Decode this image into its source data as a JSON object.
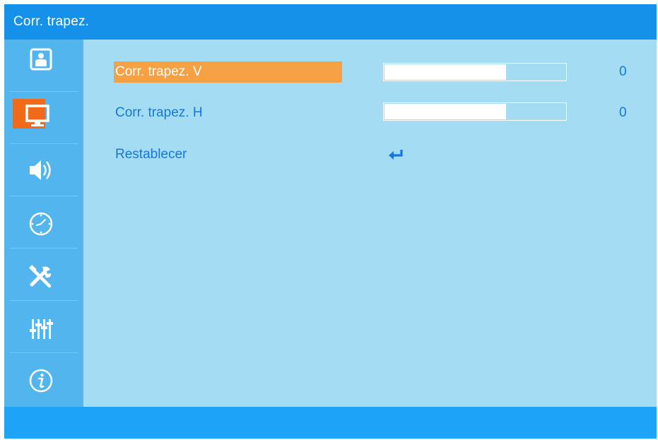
{
  "title_bar": {
    "title": "Corr. trapez."
  },
  "sidebar": {
    "items": [
      {
        "icon": "image-icon",
        "selected": false
      },
      {
        "icon": "display-icon",
        "selected": true
      },
      {
        "icon": "speaker-icon",
        "selected": false
      },
      {
        "icon": "clock-icon",
        "selected": false
      },
      {
        "icon": "tools-icon",
        "selected": false
      },
      {
        "icon": "equalizer-icon",
        "selected": false
      },
      {
        "icon": "info-icon",
        "selected": false
      }
    ]
  },
  "menu": {
    "rows": [
      {
        "label": "Corr. trapez. V",
        "value": "0",
        "level": 0.67,
        "active": true
      },
      {
        "label": "Corr. trapez. H",
        "value": "0",
        "level": 0.67,
        "active": false
      },
      {
        "label": "Restablecer",
        "icon": "enter-icon",
        "active": false
      }
    ]
  },
  "colors": {
    "title_bar": "#1591ea",
    "sidebar": "#52b5ee",
    "content": "#a4dcf4",
    "highlight": "#f4a043",
    "selected_icon_bg": "#f06a1a",
    "text": "#1578d8",
    "bottom_bar": "#1ea4f7"
  }
}
